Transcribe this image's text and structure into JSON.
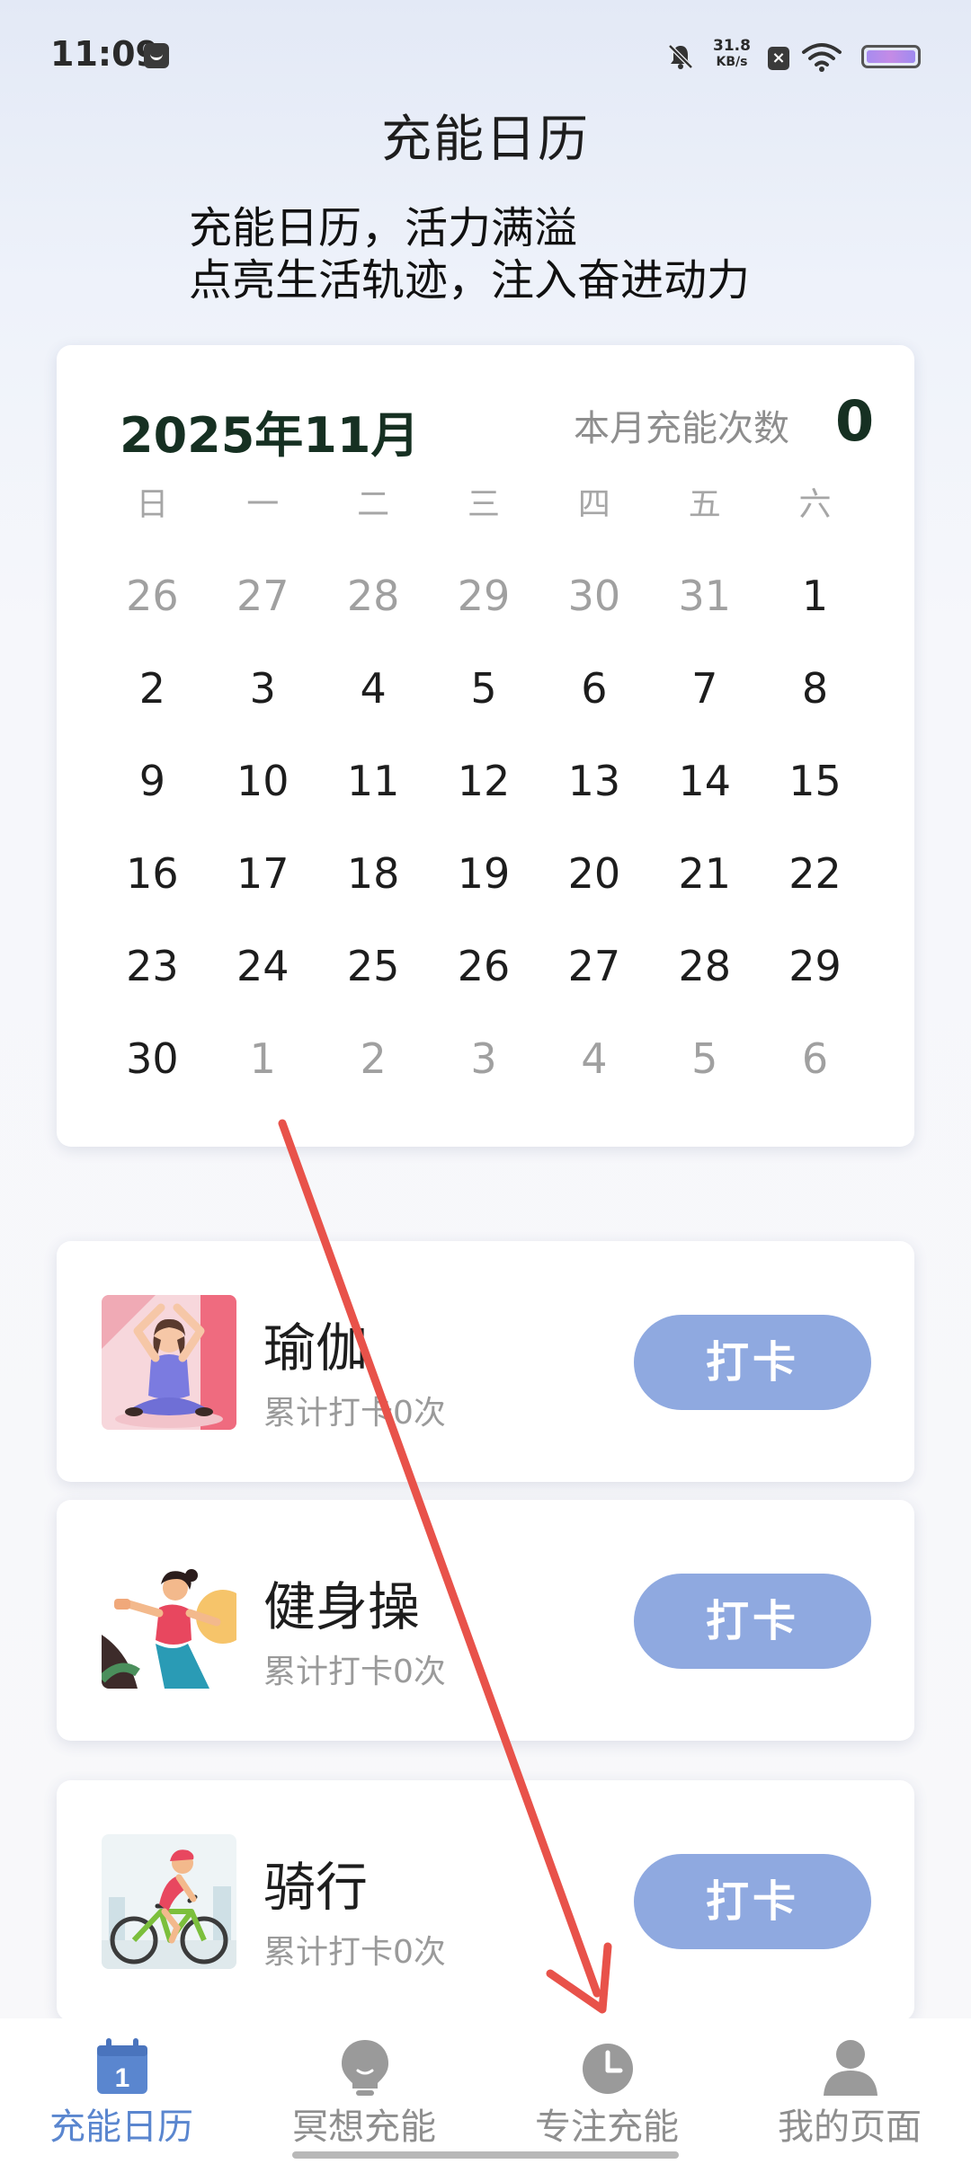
{
  "status_bar": {
    "time": "11:09",
    "net_speed_value": "31.8",
    "net_speed_unit": "KB/s"
  },
  "header": {
    "title": "充能日历",
    "slogan_line1": "充能日历，活力满溢",
    "slogan_line2": "点亮生活轨迹，注入奋进动力"
  },
  "calendar": {
    "month_label": "2025年11月",
    "count_label": "本月充能次数",
    "count_value": "0",
    "weekdays": [
      "日",
      "一",
      "二",
      "三",
      "四",
      "五",
      "六"
    ],
    "days": [
      {
        "d": "26",
        "cur": false
      },
      {
        "d": "27",
        "cur": false
      },
      {
        "d": "28",
        "cur": false
      },
      {
        "d": "29",
        "cur": false
      },
      {
        "d": "30",
        "cur": false
      },
      {
        "d": "31",
        "cur": false
      },
      {
        "d": "1",
        "cur": true
      },
      {
        "d": "2",
        "cur": true
      },
      {
        "d": "3",
        "cur": true
      },
      {
        "d": "4",
        "cur": true
      },
      {
        "d": "5",
        "cur": true
      },
      {
        "d": "6",
        "cur": true
      },
      {
        "d": "7",
        "cur": true
      },
      {
        "d": "8",
        "cur": true
      },
      {
        "d": "9",
        "cur": true
      },
      {
        "d": "10",
        "cur": true
      },
      {
        "d": "11",
        "cur": true
      },
      {
        "d": "12",
        "cur": true
      },
      {
        "d": "13",
        "cur": true
      },
      {
        "d": "14",
        "cur": true
      },
      {
        "d": "15",
        "cur": true
      },
      {
        "d": "16",
        "cur": true
      },
      {
        "d": "17",
        "cur": true
      },
      {
        "d": "18",
        "cur": true
      },
      {
        "d": "19",
        "cur": true
      },
      {
        "d": "20",
        "cur": true
      },
      {
        "d": "21",
        "cur": true
      },
      {
        "d": "22",
        "cur": true
      },
      {
        "d": "23",
        "cur": true
      },
      {
        "d": "24",
        "cur": true
      },
      {
        "d": "25",
        "cur": true
      },
      {
        "d": "26",
        "cur": true
      },
      {
        "d": "27",
        "cur": true
      },
      {
        "d": "28",
        "cur": true
      },
      {
        "d": "29",
        "cur": true
      },
      {
        "d": "30",
        "cur": true
      },
      {
        "d": "1",
        "cur": false
      },
      {
        "d": "2",
        "cur": false
      },
      {
        "d": "3",
        "cur": false
      },
      {
        "d": "4",
        "cur": false
      },
      {
        "d": "5",
        "cur": false
      },
      {
        "d": "6",
        "cur": false
      }
    ]
  },
  "activities": [
    {
      "name": "瑜伽",
      "count_text": "累计打卡0次",
      "button_label": "打卡",
      "icon": "yoga-illustration"
    },
    {
      "name": "健身操",
      "count_text": "累计打卡0次",
      "button_label": "打卡",
      "icon": "aerobics-illustration"
    },
    {
      "name": "骑行",
      "count_text": "累计打卡0次",
      "button_label": "打卡",
      "icon": "cycling-illustration"
    }
  ],
  "bottom_nav": {
    "items": [
      {
        "label": "充能日历",
        "icon": "calendar-icon",
        "active": true
      },
      {
        "label": "冥想充能",
        "icon": "lightbulb-icon",
        "active": false
      },
      {
        "label": "专注充能",
        "icon": "clock-icon",
        "active": false
      },
      {
        "label": "我的页面",
        "icon": "person-icon",
        "active": false
      }
    ]
  },
  "colors": {
    "accent": "#5a86cf",
    "button": "#8fa9e0",
    "annotation_arrow": "#e8524a",
    "calendar_month_text": "#163022"
  }
}
